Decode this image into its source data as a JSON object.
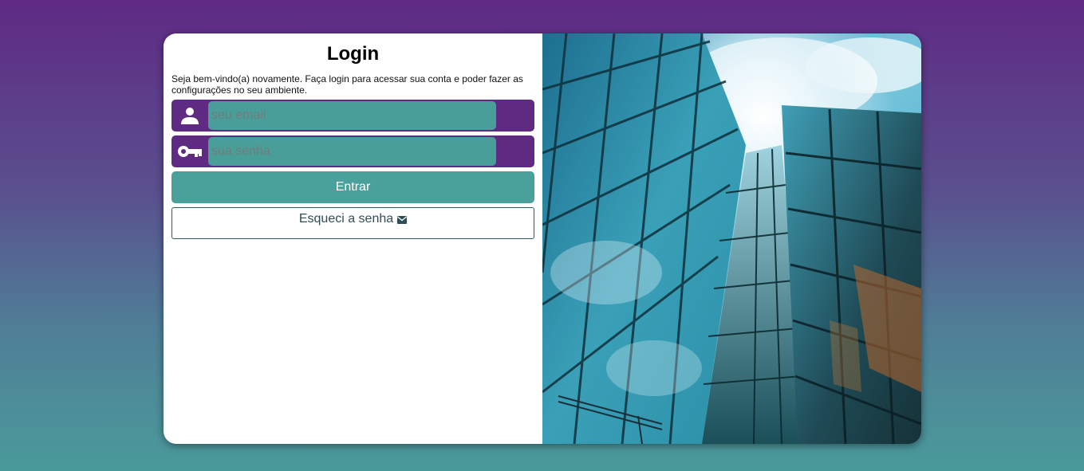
{
  "login": {
    "title": "Login",
    "subtitle": "Seja bem-vindo(a) novamente. Faça login para acessar sua conta e poder fazer as configurações no seu ambiente.",
    "email_placeholder": "seu email",
    "password_placeholder": "sua senha",
    "submit_label": "Entrar",
    "forgot_label": "Esqueci a senha",
    "icons": {
      "email": "user-icon",
      "password": "key-icon",
      "forgot": "mail-icon"
    }
  },
  "hero": {
    "image": "glass-skyscrapers-photo"
  },
  "colors": {
    "background_top": "#5f2a84",
    "background_bottom": "#4a9a9a",
    "field_row": "#5e2a82",
    "field_input": "#4a9e9a",
    "primary_button": "#4aa09a",
    "secondary_text": "#2e4d57"
  }
}
